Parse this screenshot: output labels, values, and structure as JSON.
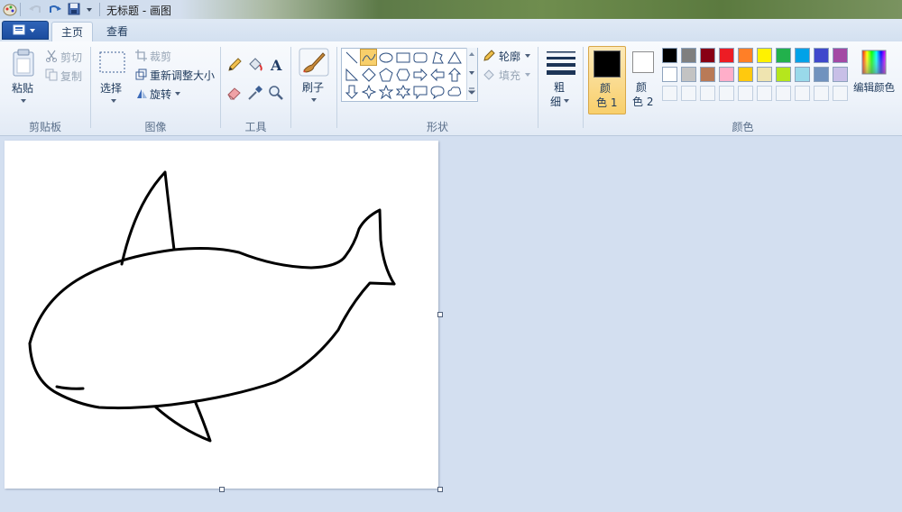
{
  "window": {
    "title": "无标题 - 画图"
  },
  "tabs": [
    {
      "label": "主页"
    },
    {
      "label": "查看"
    }
  ],
  "clipboard": {
    "group_label": "剪贴板",
    "paste": "粘贴",
    "cut": "剪切",
    "copy": "复制"
  },
  "image": {
    "group_label": "图像",
    "select": "选择",
    "crop": "裁剪",
    "resize": "重新调整大小",
    "rotate": "旋转"
  },
  "tools": {
    "group_label": "工具"
  },
  "brushes": {
    "label": "刷子"
  },
  "shapes": {
    "group_label": "形状",
    "outline": "轮廓",
    "fill": "填充"
  },
  "size": {
    "label_line1": "粗",
    "label_line2": "细"
  },
  "colors": {
    "group_label": "颜色",
    "color1_line1": "颜",
    "color1_line2": "色 1",
    "color2_line1": "颜",
    "color2_line2": "色 2",
    "color1_value": "#000000",
    "color2_value": "#ffffff",
    "edit_label": "编辑颜色",
    "palette_row1": [
      "#000000",
      "#7f7f7f",
      "#880015",
      "#ed1c24",
      "#ff7f27",
      "#fff200",
      "#22b14c",
      "#00a2e8",
      "#3f48cc",
      "#a349a4"
    ],
    "palette_row2": [
      "#ffffff",
      "#c3c3c3",
      "#b97a57",
      "#ffaec9",
      "#ffc90e",
      "#efe4b0",
      "#b5e61d",
      "#99d9ea",
      "#7092be",
      "#c8bfe7"
    ]
  },
  "accent": "#f8cf6b"
}
